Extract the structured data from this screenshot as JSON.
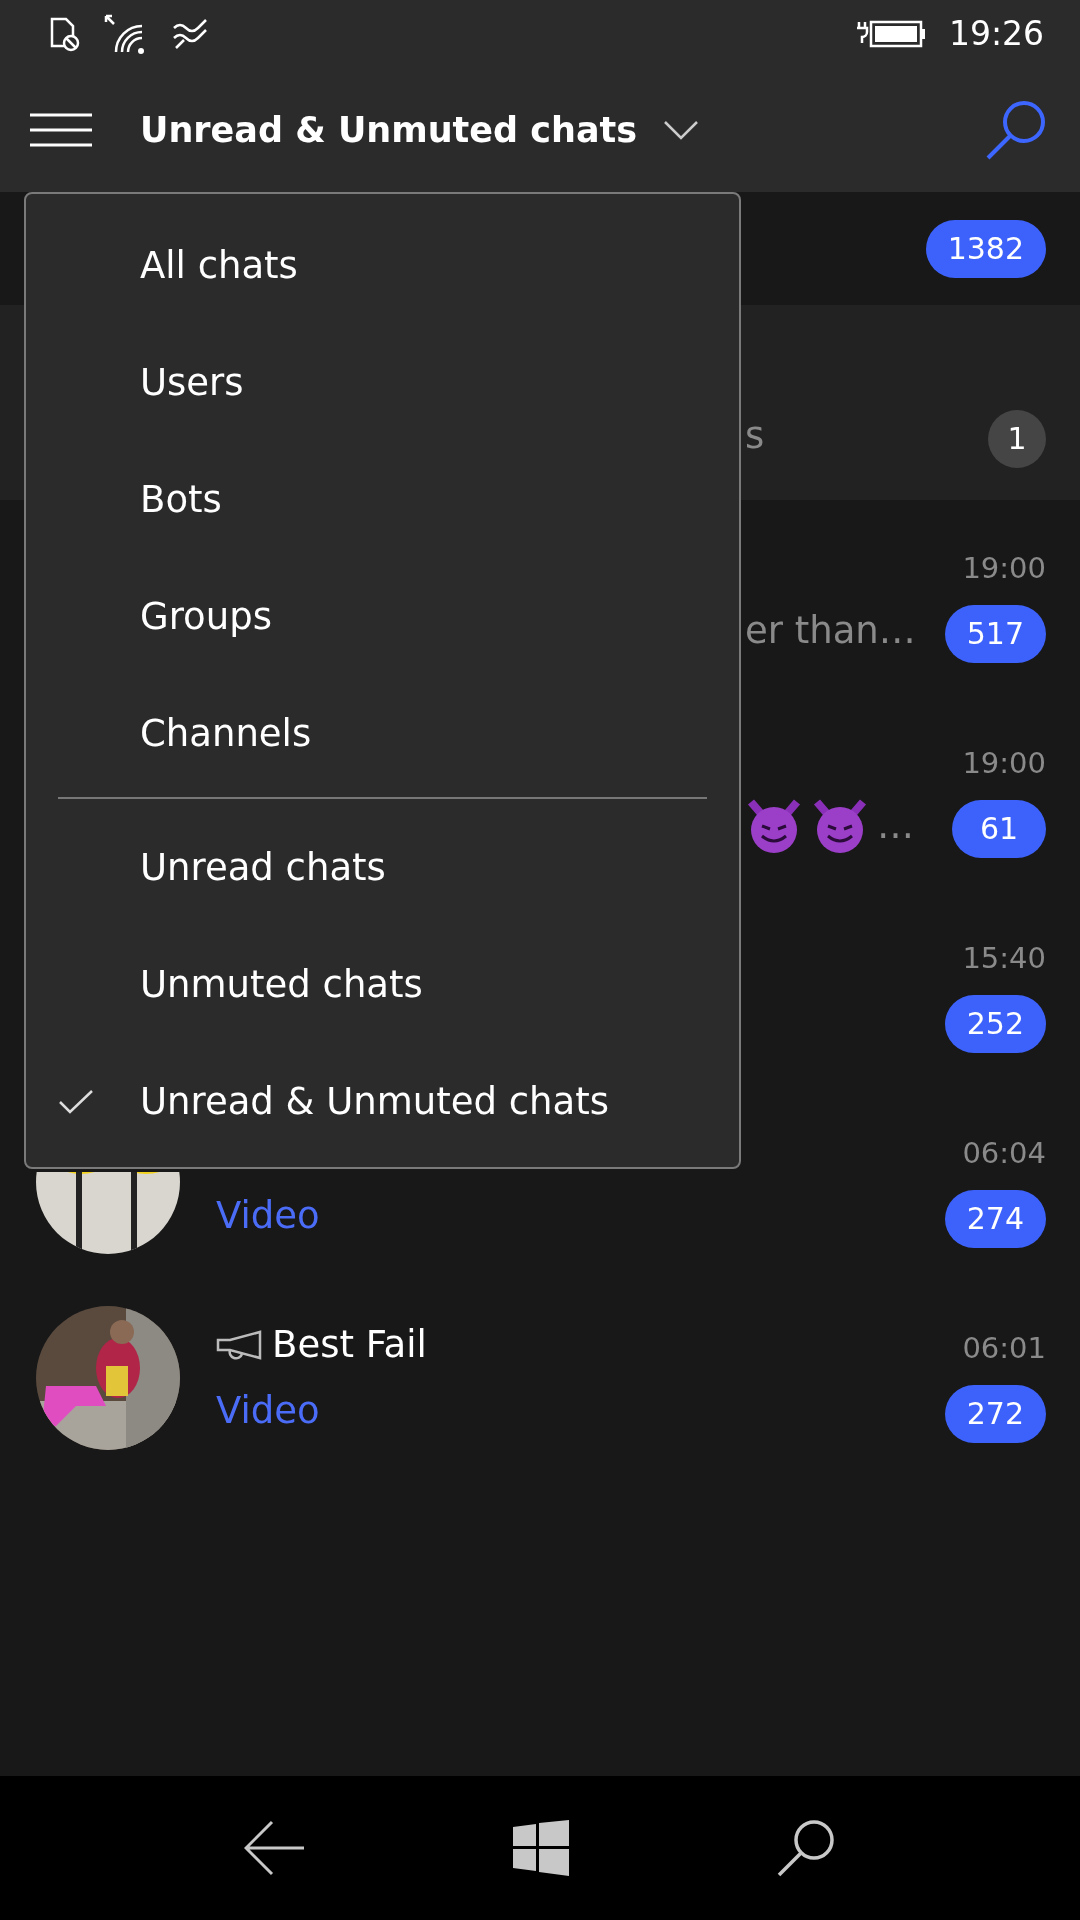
{
  "status_bar": {
    "time": "19:26"
  },
  "header": {
    "title": "Unread & Unmuted chats"
  },
  "chats": [
    {
      "kind": "banner",
      "badge": "1382",
      "muted": false
    },
    {
      "kind": "archive",
      "preview": {
        "kind": "text",
        "text": "s"
      },
      "badge": "1",
      "muted": true
    },
    {
      "kind": "covered",
      "time": "19:00",
      "preview": {
        "kind": "text",
        "text": "er than…"
      },
      "badge": "517",
      "muted": false
    },
    {
      "kind": "covered",
      "time": "19:00",
      "preview": {
        "kind": "emoji",
        "text": "…"
      },
      "badge": "61",
      "muted": false
    },
    {
      "kind": "covered",
      "time": "15:40",
      "badge": "252",
      "muted": false
    },
    {
      "kind": "chat",
      "time": "06:04",
      "preview": {
        "kind": "media",
        "text": "Video"
      },
      "badge": "274",
      "muted": false
    },
    {
      "kind": "chat",
      "channel": true,
      "name": "Best Fail",
      "time": "06:01",
      "preview": {
        "kind": "media",
        "text": "Video"
      },
      "badge": "272",
      "muted": false
    }
  ],
  "filter_menu": {
    "groups": [
      [
        {
          "label": "All chats",
          "selected": false
        },
        {
          "label": "Users",
          "selected": false
        },
        {
          "label": "Bots",
          "selected": false
        },
        {
          "label": "Groups",
          "selected": false
        },
        {
          "label": "Channels",
          "selected": false
        }
      ],
      [
        {
          "label": "Unread chats",
          "selected": false
        },
        {
          "label": "Unmuted chats",
          "selected": false
        },
        {
          "label": "Unread & Unmuted chats",
          "selected": true
        }
      ]
    ]
  }
}
